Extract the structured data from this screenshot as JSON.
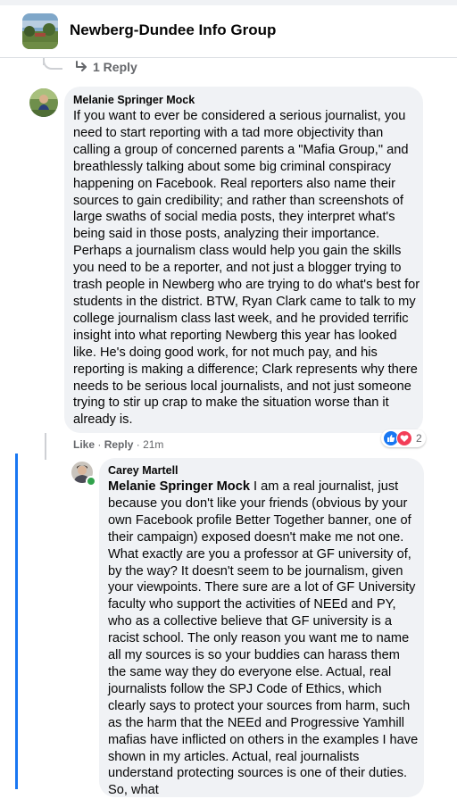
{
  "header": {
    "group_name": "Newberg-Dundee Info Group"
  },
  "thread": {
    "reply_count_label": "1 Reply"
  },
  "comment1": {
    "author": "Melanie Springer Mock",
    "text": "If you want to ever be considered a serious journalist, you need to start reporting with a tad more objectivity than calling a group of concerned parents a \"Mafia Group,\" and breathlessly talking about some big criminal conspiracy happening on Facebook. Real reporters also name their sources to gain credibility; and rather than screenshots of large swaths of social media posts, they interpret what's being said in those posts, analyzing their importance. Perhaps a journalism class would help you gain the skills you need to be a reporter, and not just a blogger trying to trash people in Newberg who are trying to do what's best for students in the district. BTW, Ryan Clark came to talk to my college journalism class last week, and he provided terrific insight into what reporting Newberg this year has looked like. He's doing good work, for not much pay, and his reporting is making a difference; Clark represents why there needs to be serious local journalists, and not just someone trying to stir up crap to make the situation worse than it already is.",
    "like_label": "Like",
    "reply_label": "Reply",
    "separator": "·",
    "time": "21m",
    "reaction_count": "2",
    "reactions": [
      "like-reaction",
      "love-reaction"
    ]
  },
  "comment2": {
    "author": "Carey Martell",
    "mention": "Melanie Springer Mock",
    "text": " I am a real journalist, just because you don't like your friends (obvious by your own Facebook profile Better Together banner, one of their campaign) exposed doesn't make me not one. What exactly are you a professor at GF university of, by the way? It doesn't seem to be journalism, given your viewpoints. There sure are a lot of GF University faculty who support the activities of NEEd and PY, who as a collective believe that GF university is a racist school. The only reason you want me to name all my sources is so your buddies can harass them the same way they do everyone else. Actual, real journalists follow the SPJ Code of Ethics, which clearly says to protect your sources from harm, such as the harm that the NEEd and Progressive Yamhill mafias have inflicted on others in the examples I have shown in my articles. Actual, real journalists understand protecting sources is one of their duties. So, what"
  },
  "colors": {
    "accent": "#1877f2",
    "bubble": "#f0f2f5",
    "meta": "#65676b",
    "love": "#f33e58",
    "online": "#31a24c"
  }
}
